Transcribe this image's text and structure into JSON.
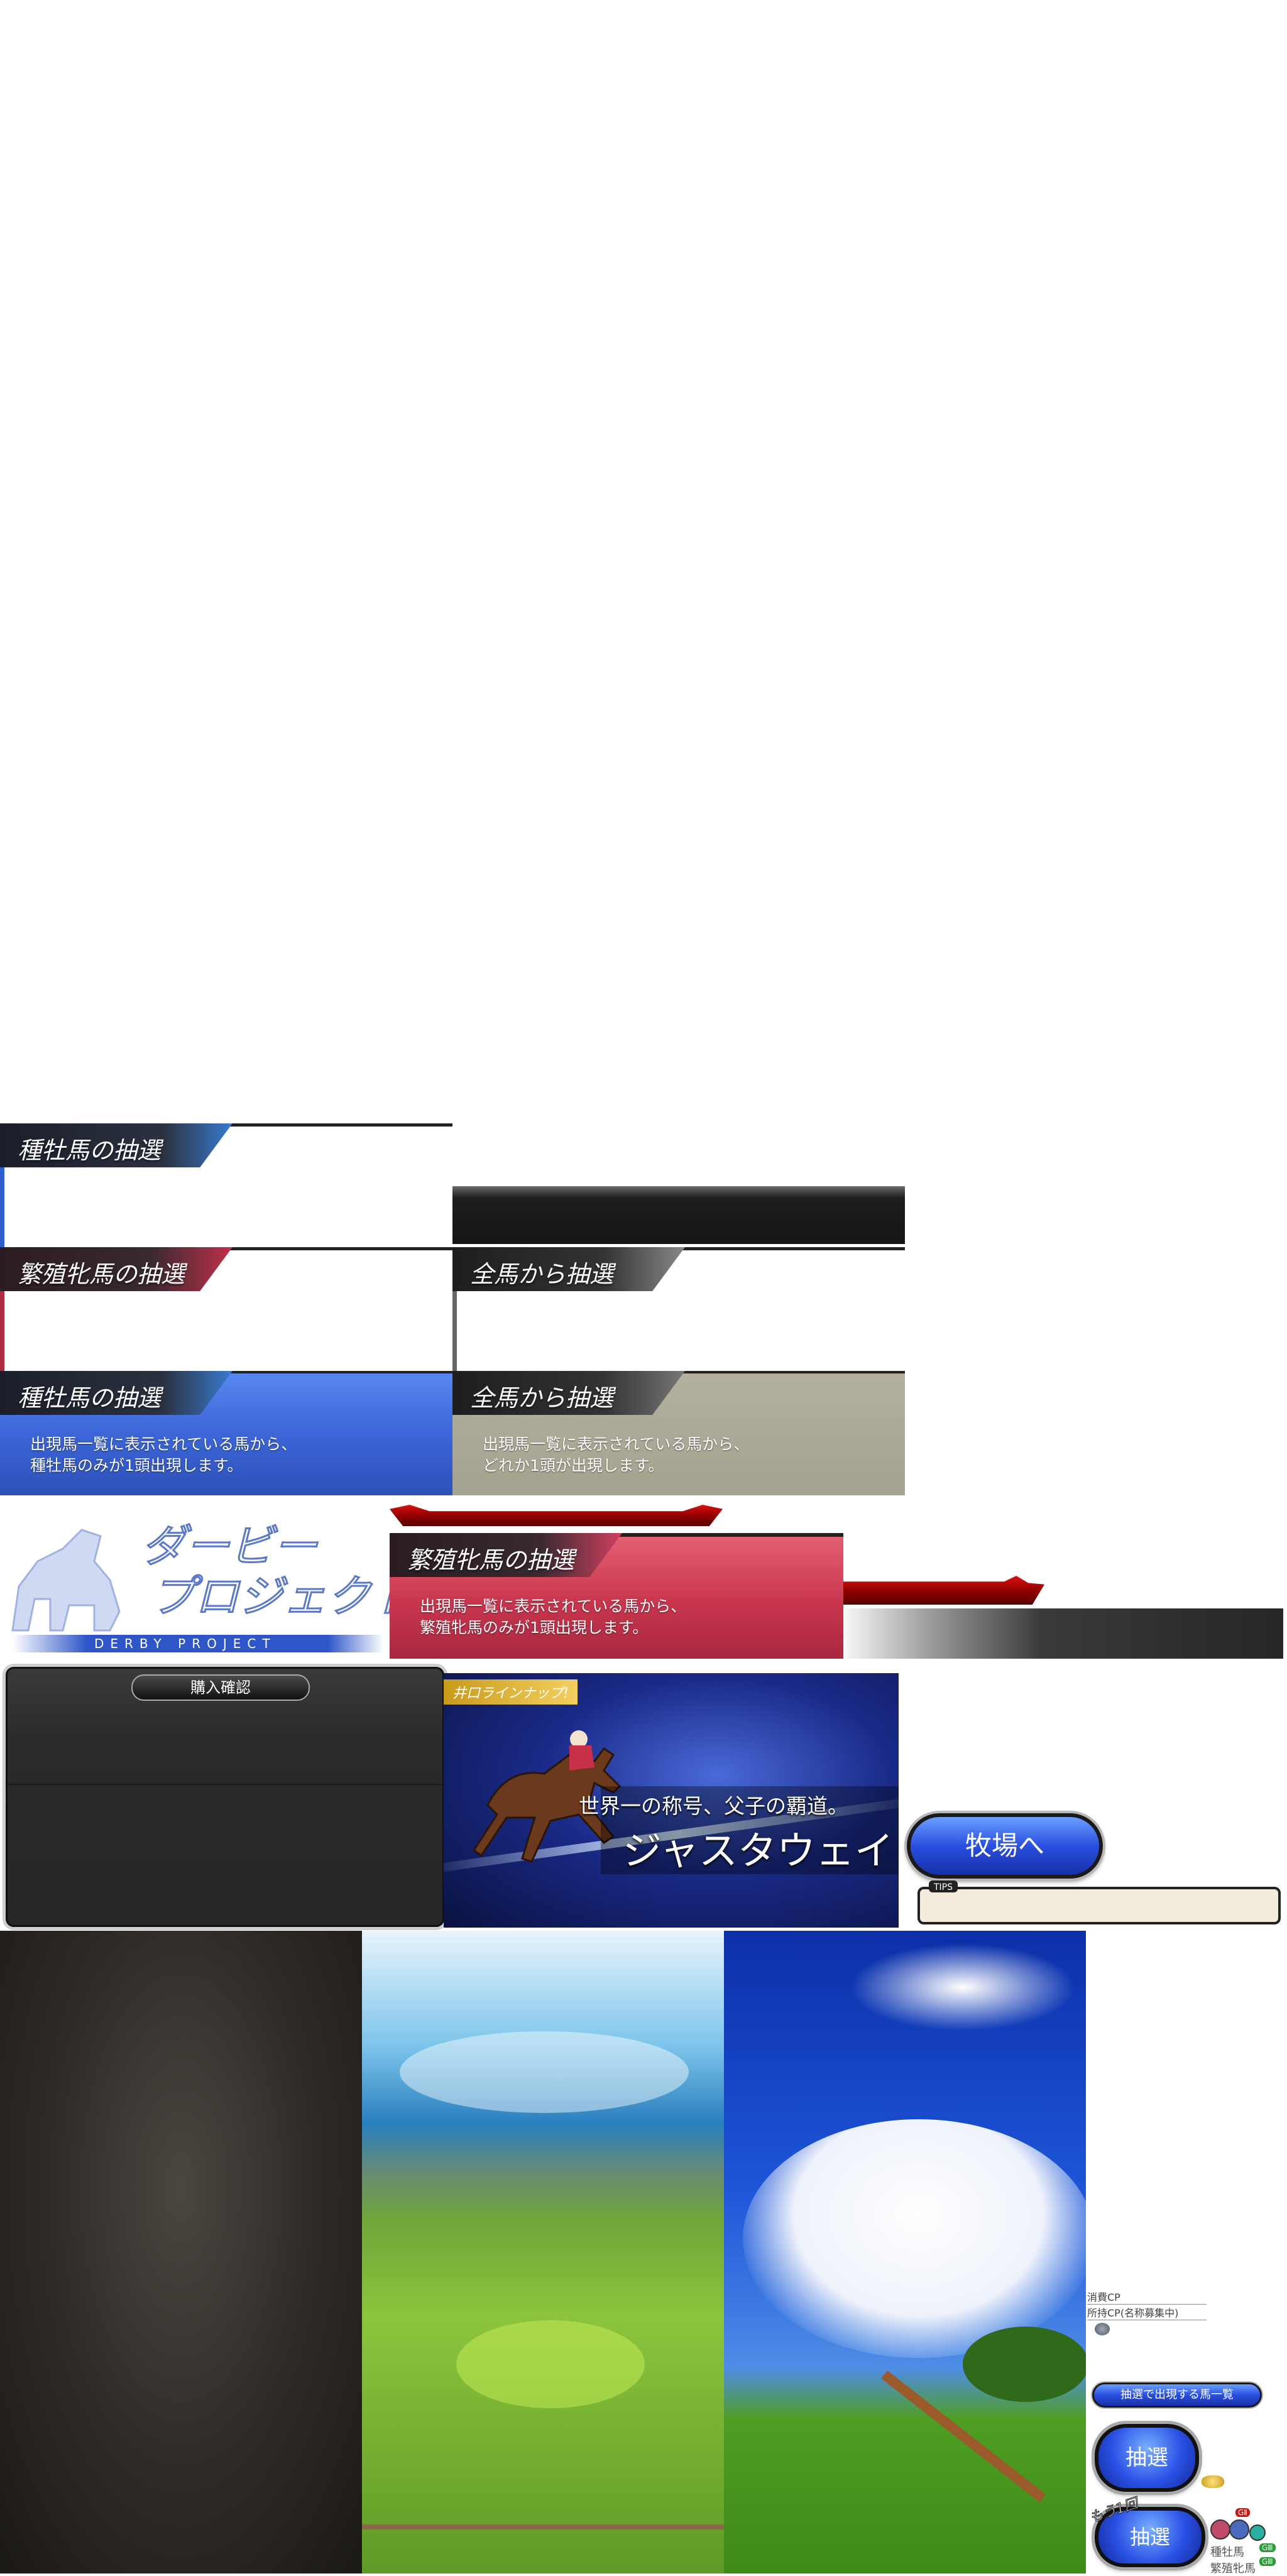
{
  "sire_lottery": {
    "title": "種牡馬の抽選",
    "desc_line1": "出現馬一覧に表示されている馬から、",
    "desc_line2": "種牡馬のみが1頭出現します。"
  },
  "mare_lottery": {
    "title": "繁殖牝馬の抽選",
    "desc_line1": "出現馬一覧に表示されている馬から、",
    "desc_line2": "繁殖牝馬のみが1頭出現します。"
  },
  "all_lottery": {
    "title": "全馬から抽選",
    "desc_line1": "出現馬一覧に表示されている馬から、",
    "desc_line2": "どれか1頭が出現します。"
  },
  "logo": {
    "title_line1": "ダービー",
    "title_line2": "プロジェクト",
    "subtitle": "DERBY PROJECT"
  },
  "purchase_dialog": {
    "title": "購入確認"
  },
  "banner": {
    "tag": "井口ラインナップ!",
    "tagline": "世界一の称号、父子の覇道。",
    "horse_name": "ジャスタウェイ"
  },
  "ranch_button": {
    "label": "牧場へ"
  },
  "tips": {
    "label": "TIPS"
  },
  "cp_info": {
    "consumed_label": "消費CP",
    "owned_label": "所持CP(名称募集中)"
  },
  "horse_list_button": {
    "label": "抽選で出現する馬一覧"
  },
  "lottery_button": {
    "label": "抽選"
  },
  "lottery_again_button": {
    "badge": "もう1回",
    "label": "抽選"
  },
  "small_labels": {
    "sire": "種牡馬",
    "mare": "繁殖牝馬"
  },
  "grade_badges": [
    "GⅡ",
    "GⅢ",
    "GⅢ"
  ],
  "colors": {
    "sire_blue": "#2f5fd0",
    "mare_red": "#c9304a",
    "all_gray": "#a8a490",
    "button_blue": "#2a4fe0"
  }
}
